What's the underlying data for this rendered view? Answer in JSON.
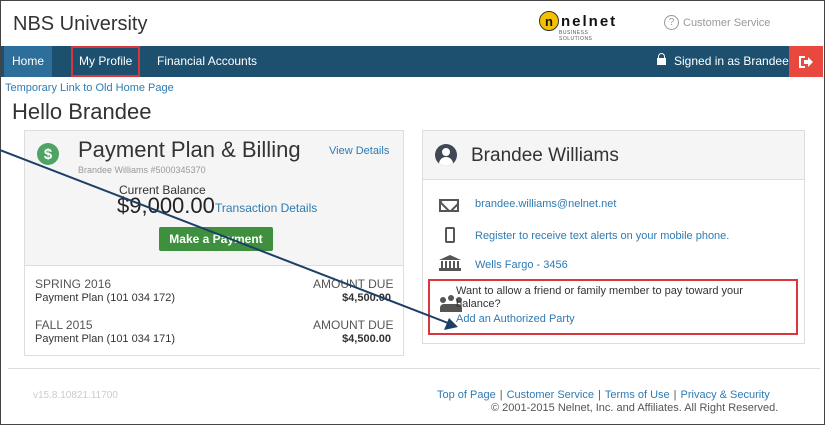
{
  "header": {
    "university": "NBS University",
    "logo_text": "nelnet",
    "logo_sub": "BUSINESS SOLUTIONS",
    "customer_service": "Customer Service"
  },
  "nav": {
    "home": "Home",
    "my_profile": "My Profile",
    "financial_accounts": "Financial Accounts",
    "signed_in": "Signed in as Brandee"
  },
  "page": {
    "temp_link": "Temporary Link to Old Home Page",
    "greeting": "Hello Brandee"
  },
  "payment": {
    "title": "Payment Plan & Billing",
    "subtitle": "Brandee Williams #5000345370",
    "view_details": "View Details",
    "current_balance_label": "Current Balance",
    "current_balance": "$9,000.00",
    "transaction_details": "Transaction Details",
    "make_payment": "Make a Payment",
    "terms": [
      {
        "term": "SPRING 2016",
        "plan": "Payment Plan (101 034 172)",
        "amount_label": "AMOUNT DUE",
        "amount": "$4,500.00"
      },
      {
        "term": "FALL 2015",
        "plan": "Payment Plan (101 034 171)",
        "amount_label": "AMOUNT DUE",
        "amount": "$4,500.00"
      }
    ]
  },
  "profile": {
    "name": "Brandee Williams",
    "email": "brandee.williams@nelnet.net",
    "text_alerts": "Register to receive text alerts on your mobile phone.",
    "bank": "Wells Fargo - 3456",
    "auth_question": "Want to allow a friend or family member to pay toward your balance?",
    "auth_link": "Add an Authorized Party"
  },
  "footer": {
    "version": "v15.8.10821.11700",
    "links": [
      "Top of Page",
      "Customer Service",
      "Terms of Use",
      "Privacy & Security"
    ],
    "copyright": "© 2001-2015 Nelnet, Inc. and Affiliates. All Right Reserved."
  },
  "colors": {
    "navbar": "#1d4f6f",
    "highlight": "#d9363e",
    "link": "#2e7bb3",
    "button": "#3e8f3e",
    "signout": "#e8483d"
  }
}
